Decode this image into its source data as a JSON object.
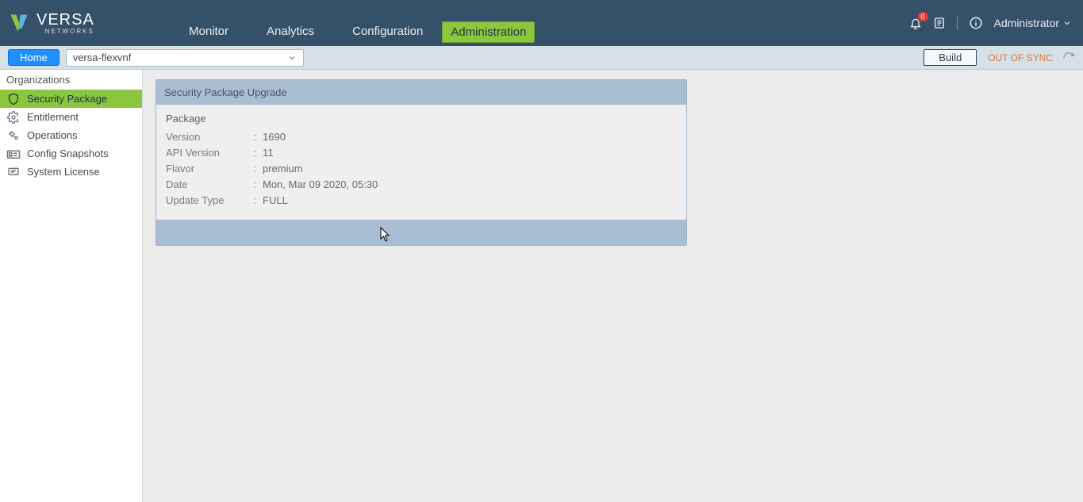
{
  "brand": {
    "name": "VERSA",
    "sub": "NETWORKS"
  },
  "topnav": {
    "items": [
      "Monitor",
      "Analytics",
      "Configuration",
      "Administration"
    ],
    "active_index": 3
  },
  "header": {
    "notification_count": "0",
    "user_label": "Administrator"
  },
  "subbar": {
    "home_label": "Home",
    "selector_value": "versa-flexvnf",
    "build_label": "Build",
    "sync_status": "OUT OF SYNC"
  },
  "sidebar": {
    "heading": "Organizations",
    "items": [
      {
        "label": "Security Package",
        "icon": "shield-refresh-icon"
      },
      {
        "label": "Entitlement",
        "icon": "gear-icon"
      },
      {
        "label": "Operations",
        "icon": "cogs-icon"
      },
      {
        "label": "Config Snapshots",
        "icon": "snapshot-icon"
      },
      {
        "label": "System License",
        "icon": "license-icon"
      }
    ],
    "active_index": 0
  },
  "panel": {
    "title": "Security Package Upgrade",
    "section": "Package",
    "rows": [
      {
        "k": "Version",
        "v": "1690"
      },
      {
        "k": "API Version",
        "v": "11"
      },
      {
        "k": "Flavor",
        "v": "premium"
      },
      {
        "k": "Date",
        "v": "Mon, Mar 09 2020, 05:30"
      },
      {
        "k": "Update Type",
        "v": "FULL"
      }
    ]
  }
}
